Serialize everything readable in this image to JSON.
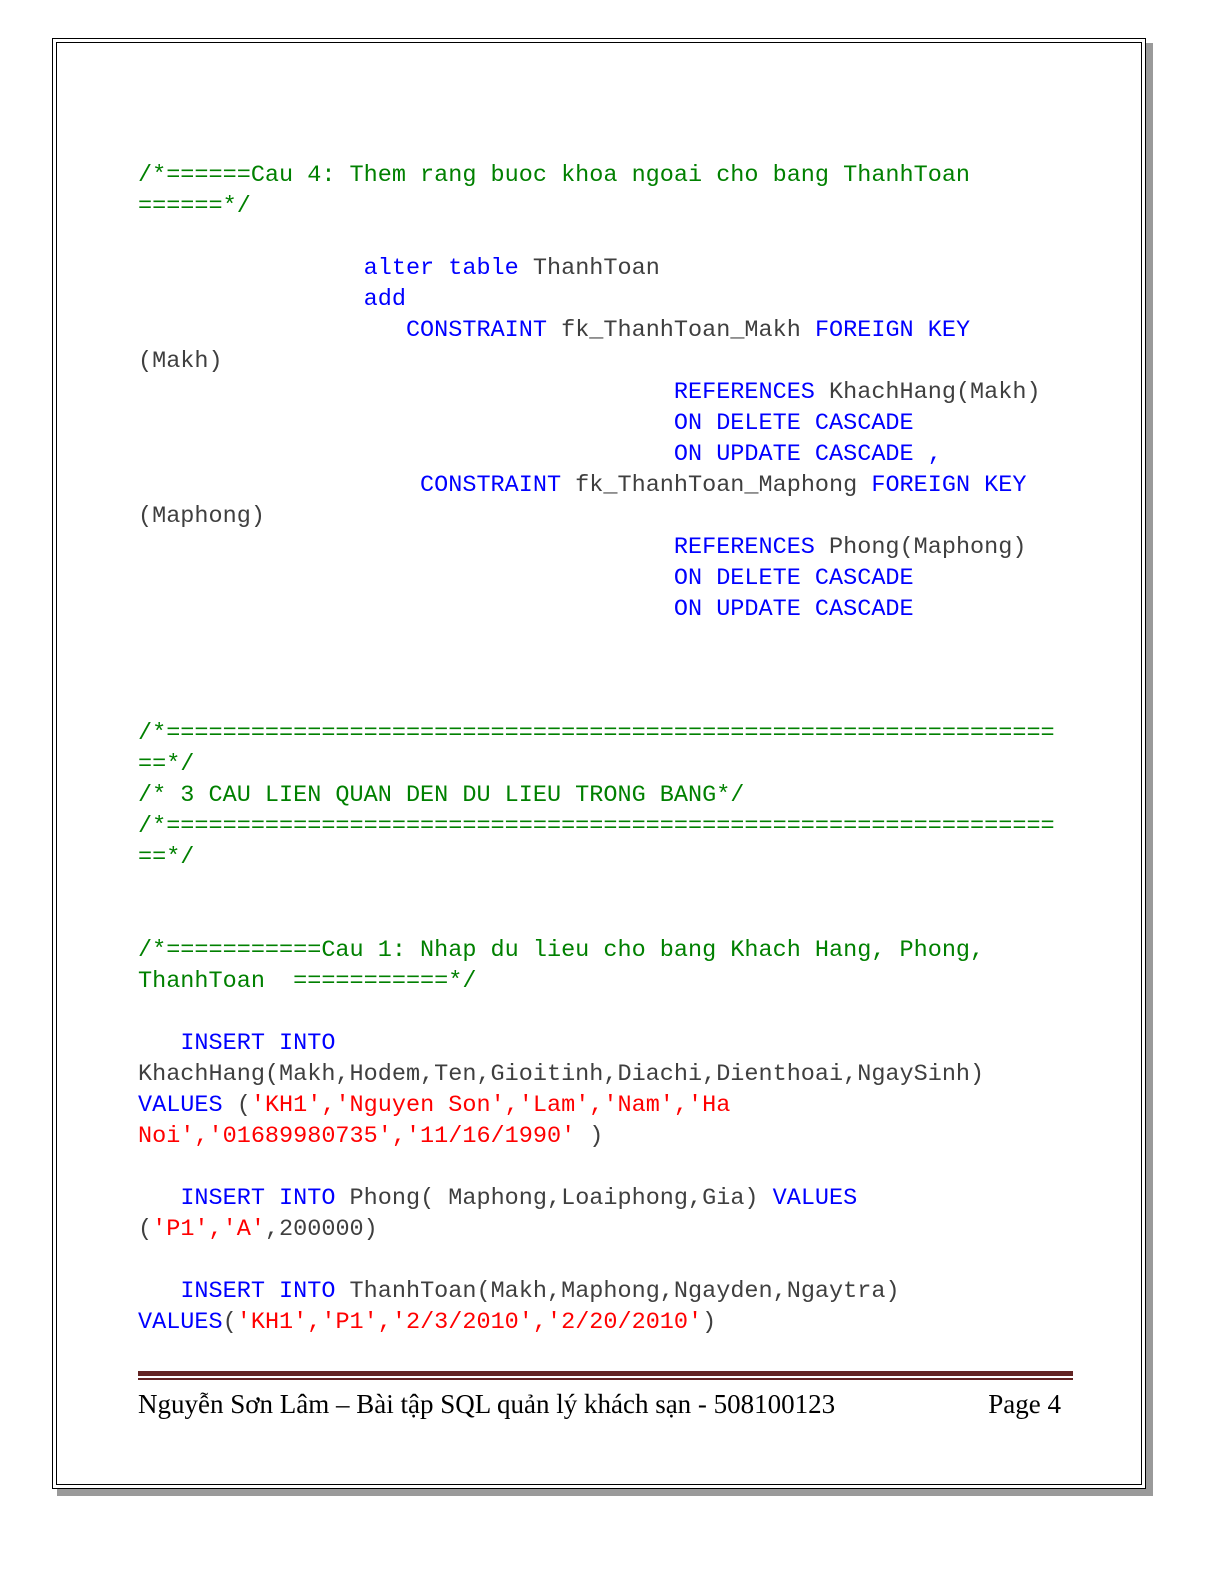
{
  "document": {
    "page_number_label": "Page 4",
    "footer_text": "Nguyễn Sơn Lâm – Bài tập SQL quản lý khách sạn - 508100123"
  },
  "code": {
    "comment_cau4_line1": "/*======Cau 4: Them rang buoc khoa ngoai cho bang ThanhToan ======*/",
    "alter_table_kw": "alter table",
    "alter_table_target": " ThanhToan",
    "add_kw": "add",
    "constraint_kw_1": "CONSTRAINT",
    "constraint_name_1": " fk_ThanhToan_Makh ",
    "foreign_key_kw_1": "FOREIGN KEY",
    "foreign_key_cols_1": " (Makh)",
    "references_kw_1": "REFERENCES",
    "references_target_1": " KhachHang(Makh)",
    "on_delete_cascade_1": "ON DELETE CASCADE",
    "on_update_cascade_1": "ON UPDATE CASCADE ,",
    "constraint_kw_2": "CONSTRAINT",
    "constraint_name_2": " fk_ThanhToan_Maphong ",
    "foreign_key_kw_2": "FOREIGN KEY",
    "foreign_key_cols_2": " (Maphong)",
    "references_kw_2": "REFERENCES",
    "references_target_2": " Phong(Maphong)",
    "on_delete_cascade_2": "ON DELETE CASCADE",
    "on_update_cascade_2": "ON UPDATE CASCADE",
    "separator_top": "/*=================================================================*/",
    "section_title_comment": "/* 3 CAU LIEN QUAN DEN DU LIEU TRONG BANG*/",
    "separator_bottom": "/*=================================================================*/",
    "comment_cau1": "/*===========Cau 1: Nhap du lieu cho bang Khach Hang, Phong, ThanhToan  ===========*/",
    "insert_into_kw_1": "INSERT INTO",
    "insert_target_1": "KhachHang(Makh,Hodem,Ten,Gioitinh,Diachi,Dienthoai,NgaySinh) ",
    "values_kw_1": "VALUES",
    "values_open_1": " (",
    "values_list_1": "'KH1','Nguyen Son','Lam','Nam','Ha Noi','01689980735','11/16/1990'",
    "values_close_1": " )",
    "insert_into_kw_2": "INSERT INTO",
    "insert_target_2": " Phong( Maphong,Loaiphong,Gia) ",
    "values_kw_2": "VALUES",
    "values_open_2": "(",
    "values_str_2a": "'P1','A'",
    "values_num_2": ",200000",
    "values_close_2": ")",
    "insert_into_kw_3": "INSERT INTO",
    "insert_target_3": " ThanhToan(Makh,Maphong,Ngayden,Ngaytra)",
    "values_kw_3": "VALUES",
    "values_open_3": "(",
    "values_list_3": "'KH1','P1','2/3/2010','2/20/2010'",
    "values_close_3": ")"
  }
}
